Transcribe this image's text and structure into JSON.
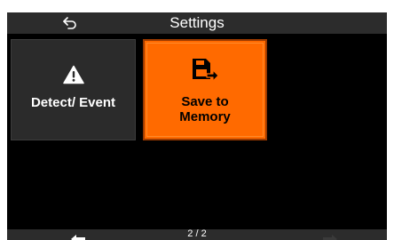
{
  "header": {
    "title": "Settings",
    "back_icon": "back-arrow-icon"
  },
  "tiles": [
    {
      "label": "Detect/ Event",
      "icon": "warning-triangle-icon",
      "selected": false
    },
    {
      "label": "Save to\nMemory",
      "icon": "save-to-memory-icon",
      "selected": true
    }
  ],
  "footer": {
    "page_indicator": "2 / 2",
    "prev_icon": "left-arrow-icon",
    "next_icon": "right-arrow-icon"
  },
  "colors": {
    "screen_background": "#000000",
    "bar_background": "#2c2c2c",
    "tile_background": "#2b2b2b",
    "selected_tile": "#ff6a00",
    "selected_border": "#9c3a00"
  }
}
